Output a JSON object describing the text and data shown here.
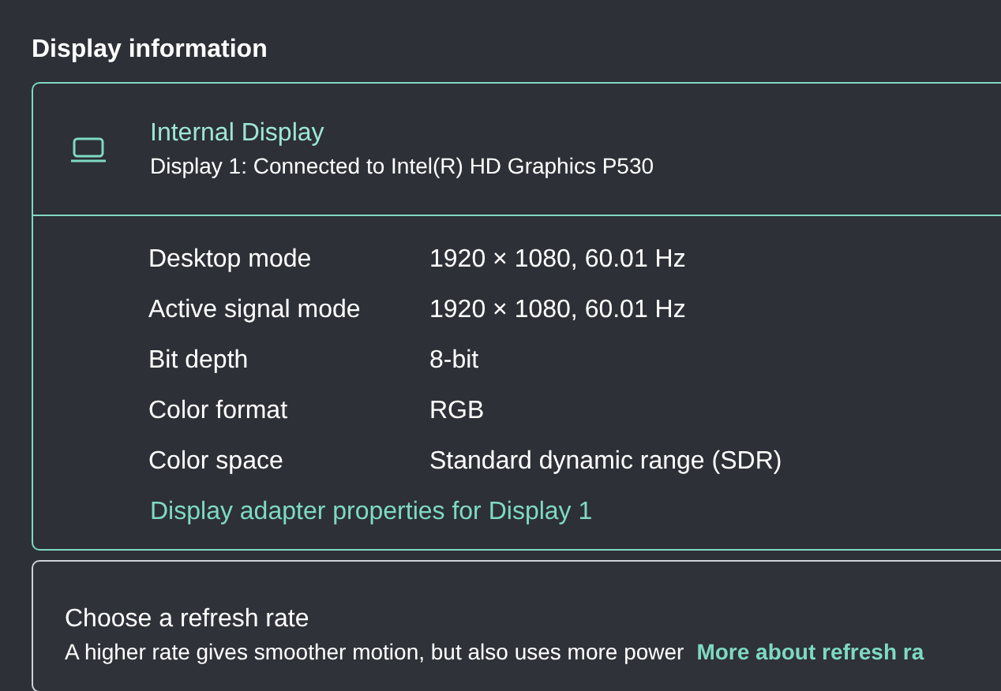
{
  "section_title": "Display information",
  "display_card": {
    "name": "Internal Display",
    "subtitle": "Display 1: Connected to Intel(R) HD Graphics P530",
    "properties": [
      {
        "label": "Desktop mode",
        "value": "1920 × 1080, 60.01 Hz"
      },
      {
        "label": "Active signal mode",
        "value": "1920 × 1080, 60.01 Hz"
      },
      {
        "label": "Bit depth",
        "value": "8-bit"
      },
      {
        "label": "Color format",
        "value": "RGB"
      },
      {
        "label": "Color space",
        "value": "Standard dynamic range (SDR)"
      }
    ],
    "link": "Display adapter properties for Display 1"
  },
  "refresh_card": {
    "title": "Choose a refresh rate",
    "description": "A higher rate gives smoother motion, but also uses more power",
    "link": "More about refresh ra"
  }
}
